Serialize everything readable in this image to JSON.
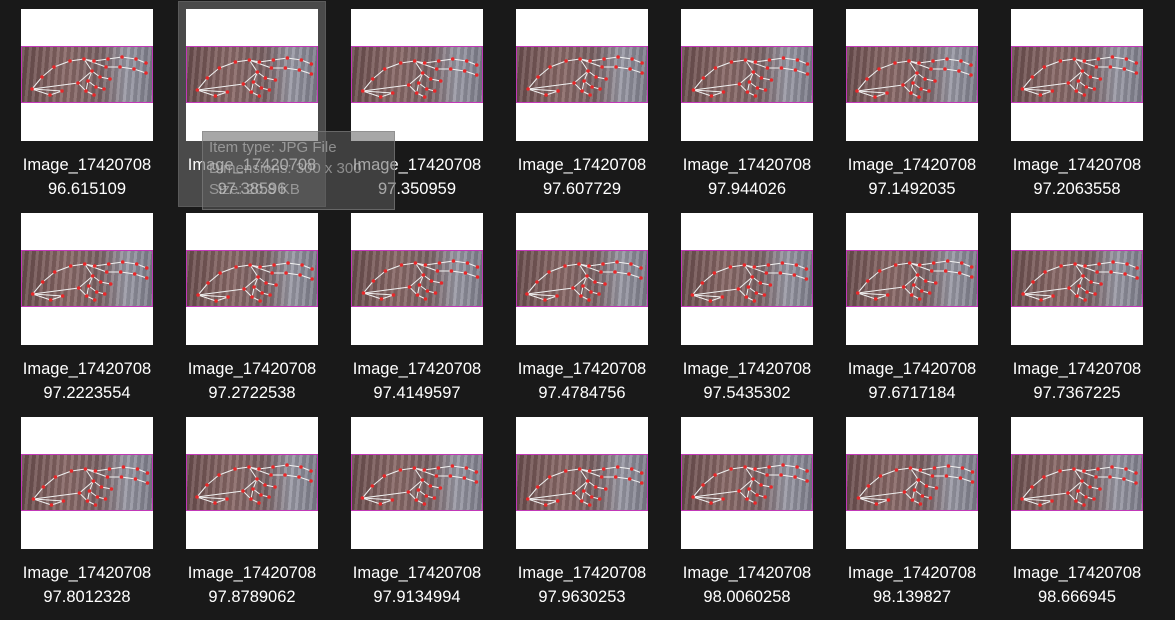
{
  "window": {
    "view": "Large icons"
  },
  "files": [
    {
      "name_line1": "Image_17420708",
      "name_line2": "96.615109",
      "icon": "jpg-thumbnail"
    },
    {
      "name_line1": "Image_17420708",
      "name_line2": "97.38596",
      "icon": "jpg-thumbnail",
      "hovered": true
    },
    {
      "name_line1": "Image_17420708",
      "name_line2": "97.350959",
      "icon": "jpg-thumbnail"
    },
    {
      "name_line1": "Image_17420708",
      "name_line2": "97.607729",
      "icon": "jpg-thumbnail"
    },
    {
      "name_line1": "Image_17420708",
      "name_line2": "97.944026",
      "icon": "jpg-thumbnail"
    },
    {
      "name_line1": "Image_17420708",
      "name_line2": "97.1492035",
      "icon": "jpg-thumbnail"
    },
    {
      "name_line1": "Image_17420708",
      "name_line2": "97.2063558",
      "icon": "jpg-thumbnail"
    },
    {
      "name_line1": "Image_17420708",
      "name_line2": "97.2223554",
      "icon": "jpg-thumbnail"
    },
    {
      "name_line1": "Image_17420708",
      "name_line2": "97.2722538",
      "icon": "jpg-thumbnail"
    },
    {
      "name_line1": "Image_17420708",
      "name_line2": "97.4149597",
      "icon": "jpg-thumbnail"
    },
    {
      "name_line1": "Image_17420708",
      "name_line2": "97.4784756",
      "icon": "jpg-thumbnail"
    },
    {
      "name_line1": "Image_17420708",
      "name_line2": "97.5435302",
      "icon": "jpg-thumbnail"
    },
    {
      "name_line1": "Image_17420708",
      "name_line2": "97.6717184",
      "icon": "jpg-thumbnail"
    },
    {
      "name_line1": "Image_17420708",
      "name_line2": "97.7367225",
      "icon": "jpg-thumbnail"
    },
    {
      "name_line1": "Image_17420708",
      "name_line2": "97.8012328",
      "icon": "jpg-thumbnail"
    },
    {
      "name_line1": "Image_17420708",
      "name_line2": "97.8789062",
      "icon": "jpg-thumbnail"
    },
    {
      "name_line1": "Image_17420708",
      "name_line2": "97.9134994",
      "icon": "jpg-thumbnail"
    },
    {
      "name_line1": "Image_17420708",
      "name_line2": "97.9630253",
      "icon": "jpg-thumbnail"
    },
    {
      "name_line1": "Image_17420708",
      "name_line2": "98.0060258",
      "icon": "jpg-thumbnail"
    },
    {
      "name_line1": "Image_17420708",
      "name_line2": "98.139827",
      "icon": "jpg-thumbnail"
    },
    {
      "name_line1": "Image_17420708",
      "name_line2": "98.666945",
      "icon": "jpg-thumbnail"
    }
  ],
  "tooltip": {
    "type_line": "Item type: JPG File",
    "dimensions_line": "Dimensions: 300 x 300",
    "size_line": "Size: 20.8 KB"
  },
  "colors": {
    "background": "#191919",
    "hover_background": "#4a4a4a",
    "label_text": "#ffffff",
    "thumb_border": "#c238b8",
    "landmark_dot": "#e8282a",
    "landmark_line": "#f0f0f0"
  }
}
